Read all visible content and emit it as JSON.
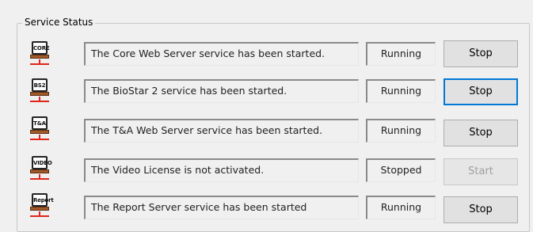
{
  "group": {
    "title": "Service Status"
  },
  "services": [
    {
      "icon": "core-server-icon",
      "icon_label": "CORE",
      "message": "The Core Web Server service has been started.",
      "status": "Running",
      "action": "Stop",
      "action_enabled": true
    },
    {
      "icon": "biostar2-server-icon",
      "icon_label": "BS2",
      "message": "The BioStar 2 service has been started.",
      "status": "Running",
      "action": "Stop",
      "action_enabled": true
    },
    {
      "icon": "ta-server-icon",
      "icon_label": "T&A",
      "message": "The T&A Web Server service has been started.",
      "status": "Running",
      "action": "Stop",
      "action_enabled": true
    },
    {
      "icon": "video-server-icon",
      "icon_label": "VIDEO",
      "message": "The Video License is not activated.",
      "status": "Stopped",
      "action": "Start",
      "action_enabled": false
    },
    {
      "icon": "report-server-icon",
      "icon_label": "Report",
      "message": "The Report Server service has been started",
      "status": "Running",
      "action": "Stop",
      "action_enabled": true
    }
  ],
  "colors": {
    "background": "#f0f0f0",
    "button_focus_border": "#0078d7",
    "disabled_text": "#a0a0a0",
    "icon_connector": "#e0261b"
  }
}
